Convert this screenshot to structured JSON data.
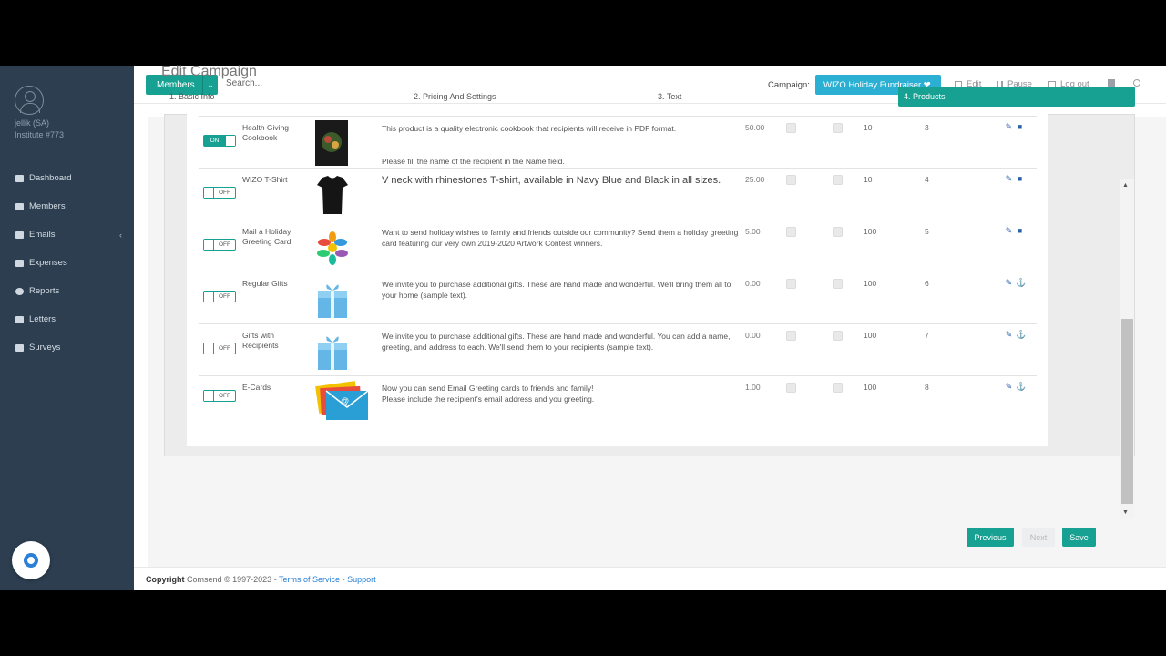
{
  "sidebar": {
    "user": "jellik (SA)",
    "institute": "Institute #773",
    "items": [
      {
        "label": "Dashboard",
        "icon": "dashboard-icon"
      },
      {
        "label": "Members",
        "icon": "users-icon"
      },
      {
        "label": "Emails",
        "icon": "envelope-icon",
        "chevron": "‹"
      },
      {
        "label": "Expenses",
        "icon": "user-icon"
      },
      {
        "label": "Reports",
        "icon": "globe-icon"
      },
      {
        "label": "Letters",
        "icon": "letter-icon"
      },
      {
        "label": "Surveys",
        "icon": "survey-icon"
      }
    ]
  },
  "topbar": {
    "members_label": "Members",
    "search_placeholder": "Search...",
    "campaign_label": "Campaign:",
    "campaign_value": "WIZO Holiday Fundraiser ❤",
    "edit": "Edit",
    "pause": "Pause",
    "logout": "Log out"
  },
  "page": {
    "title": "Edit Campaign",
    "steps": [
      "1. Basic Info",
      "2. Pricing And Settings",
      "3. Text",
      "4. Products"
    ],
    "active_step": 3
  },
  "products": [
    {
      "toggle": "ON",
      "name": "Health Giving Cookbook",
      "desc": "This product is a quality electronic cookbook that recipients will receive in PDF format.",
      "desc2": "Please fill the name of the recipient in the Name field.",
      "price": "50.00",
      "qty": "10",
      "order": "3",
      "action2": "trash-icon"
    },
    {
      "toggle": "OFF",
      "name": "WIZO T-Shirt",
      "desc": "V neck with rhinestones T-shirt, available in Navy Blue and Black in all sizes.",
      "desc2": "",
      "price": "25.00",
      "qty": "10",
      "order": "4",
      "action2": "trash-icon"
    },
    {
      "toggle": "OFF",
      "name": "Mail a Holiday Greeting Card",
      "desc": "Want to send holiday wishes to family and friends outside our community? Send them a holiday greeting card featuring our very own 2019-2020 Artwork Contest winners.",
      "desc2": "",
      "price": "5.00",
      "qty": "100",
      "order": "5",
      "action2": "trash-icon"
    },
    {
      "toggle": "OFF",
      "name": "Regular Gifts",
      "desc": "We invite you to purchase additional gifts. These are hand made and wonderful. We'll bring them all to your home (sample text).",
      "desc2": "",
      "price": "0.00",
      "qty": "100",
      "order": "6",
      "action2": "anchor-icon"
    },
    {
      "toggle": "OFF",
      "name": "Gifts with Recipients",
      "desc": "We invite you to purchase additional gifts. These are hand made and wonderful. You can add a name, greeting, and address to each. We'll send them to your recipients (sample text).",
      "desc2": "",
      "price": "0.00",
      "qty": "100",
      "order": "7",
      "action2": "anchor-icon"
    },
    {
      "toggle": "OFF",
      "name": "E-Cards",
      "desc": "Now you can send Email Greeting cards to friends and family!",
      "desc2": "Please include the recipient's email address and you greeting.",
      "price": "1.00",
      "qty": "100",
      "order": "8",
      "action2": "anchor-icon"
    }
  ],
  "buttons": {
    "previous": "Previous",
    "next": "Next",
    "save": "Save"
  },
  "footer": {
    "copyright": "Copyright",
    "text": " Comsend © 1997-2023 - ",
    "terms": "Terms of Service",
    "sep": " - ",
    "support": "Support"
  },
  "colors": {
    "accent": "#17a192",
    "sidebar": "#2c3e50",
    "campaign": "#2bb0d3"
  }
}
